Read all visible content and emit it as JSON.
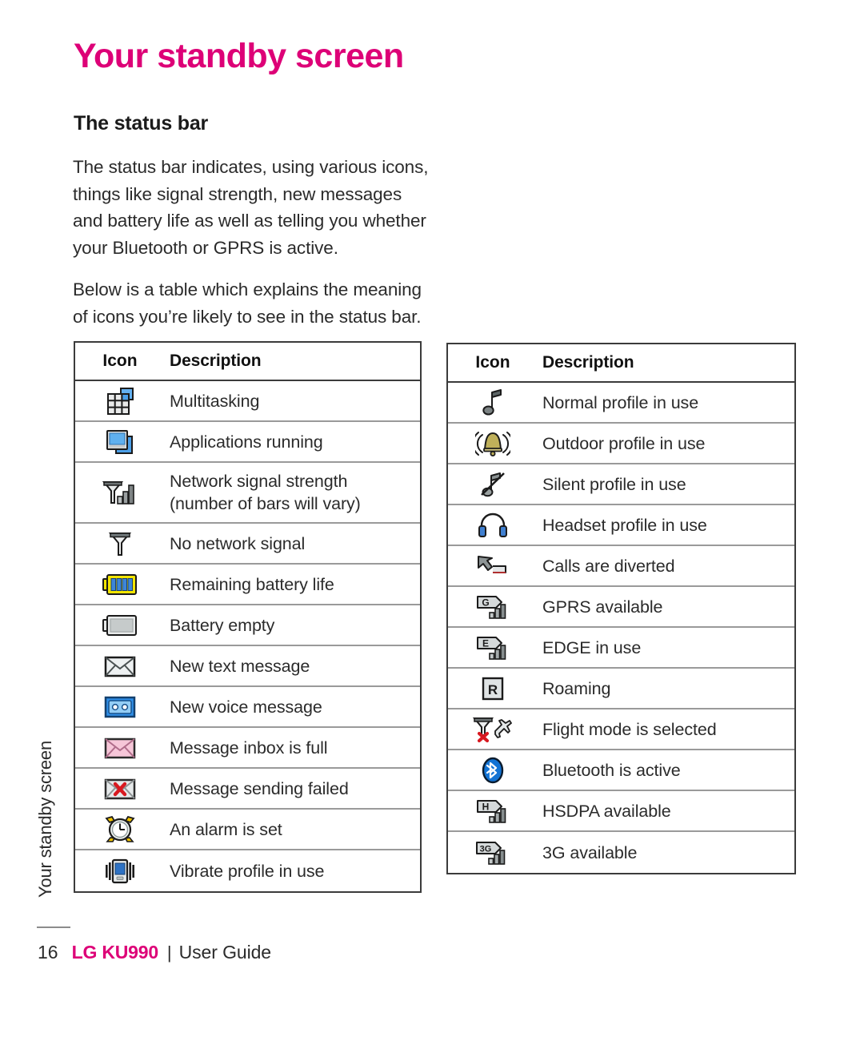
{
  "chapter": {
    "title": "Your standby screen"
  },
  "section": {
    "title": "The status bar"
  },
  "intro": {
    "paragraph1": "The status bar indicates, using various icons, things like signal strength, new messages and battery life as well as telling you whether your Bluetooth or GPRS is active.",
    "paragraph2": "Below is a table which explains the meaning of icons you’re likely to see in the status bar."
  },
  "tables": [
    {
      "id": "left",
      "header": {
        "icon": "Icon",
        "description": "Description"
      },
      "rows": [
        {
          "icon_name": "multitasking-icon",
          "description": "Multitasking"
        },
        {
          "icon_name": "applications-running-icon",
          "description": "Applications running"
        },
        {
          "icon_name": "network-signal-strength-icon",
          "description": "Network signal strength (number of bars will vary)"
        },
        {
          "icon_name": "no-network-signal-icon",
          "description": "No network signal"
        },
        {
          "icon_name": "battery-full-icon",
          "description": "Remaining battery life"
        },
        {
          "icon_name": "battery-empty-icon",
          "description": "Battery empty"
        },
        {
          "icon_name": "new-text-message-icon",
          "description": "New text message"
        },
        {
          "icon_name": "new-voice-message-icon",
          "description": "New voice message"
        },
        {
          "icon_name": "message-inbox-full-icon",
          "description": "Message inbox is full"
        },
        {
          "icon_name": "message-sending-failed-icon",
          "description": "Message sending failed"
        },
        {
          "icon_name": "alarm-set-icon",
          "description": "An alarm is set"
        },
        {
          "icon_name": "vibrate-profile-icon",
          "description": "Vibrate profile in use"
        }
      ]
    },
    {
      "id": "right",
      "header": {
        "icon": "Icon",
        "description": "Description"
      },
      "rows": [
        {
          "icon_name": "normal-profile-icon",
          "description": "Normal profile in use"
        },
        {
          "icon_name": "outdoor-profile-icon",
          "description": "Outdoor profile in use"
        },
        {
          "icon_name": "silent-profile-icon",
          "description": "Silent profile in use"
        },
        {
          "icon_name": "headset-profile-icon",
          "description": "Headset profile in use"
        },
        {
          "icon_name": "calls-diverted-icon",
          "description": "Calls are diverted"
        },
        {
          "icon_name": "gprs-available-icon",
          "description": "GPRS available"
        },
        {
          "icon_name": "edge-in-use-icon",
          "description": "EDGE in use"
        },
        {
          "icon_name": "roaming-icon",
          "description": "Roaming"
        },
        {
          "icon_name": "flight-mode-icon",
          "description": "Flight mode is selected"
        },
        {
          "icon_name": "bluetooth-active-icon",
          "description": "Bluetooth is active"
        },
        {
          "icon_name": "hsdpa-available-icon",
          "description": "HSDPA available"
        },
        {
          "icon_name": "3g-available-icon",
          "description": "3G available"
        }
      ]
    }
  ],
  "running_head": "Your standby screen",
  "footer": {
    "page_number": "16",
    "brand": "LG KU990",
    "separator": "|",
    "guide": "User Guide"
  },
  "colors": {
    "brand_magenta": "#dd0077",
    "text": "#2b2b2b",
    "table_border": "#3b3b3b",
    "row_rule": "#9a9a9a",
    "icon_blue": "#3a8fe0",
    "icon_yellow": "#f2e500",
    "icon_red": "#d81920",
    "icon_pink": "#f3c3d4",
    "bluetooth_blue": "#1273d4"
  }
}
